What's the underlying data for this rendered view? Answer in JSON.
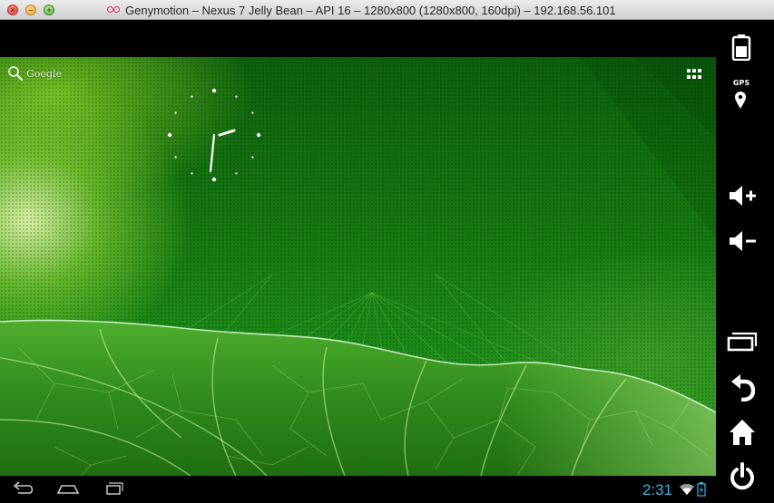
{
  "window": {
    "title": "Genymotion – Nexus 7 Jelly Bean – API 16 – 1280x800 (1280x800, 160dpi) – 192.168.56.101",
    "controls": [
      "close-icon",
      "minimize-icon",
      "zoom-icon"
    ]
  },
  "home": {
    "search_label": "Google",
    "wallpaper": "green-leaf"
  },
  "statusbar": {
    "time": "2:31",
    "icons": [
      "wifi-icon",
      "battery-icon"
    ]
  },
  "navbar": {
    "buttons": [
      "back-icon",
      "home-icon",
      "recent-apps-icon"
    ]
  },
  "sidebar": {
    "gps_label": "GPS",
    "buttons": [
      "battery-icon",
      "gps-icon",
      "volume-up-icon",
      "volume-down-icon",
      "recent-apps-icon",
      "back-icon",
      "home-icon",
      "power-icon"
    ]
  },
  "colors": {
    "accent_time": "#33b5e5",
    "wallpaper_base": "#187a12",
    "chrome": "#000000"
  }
}
